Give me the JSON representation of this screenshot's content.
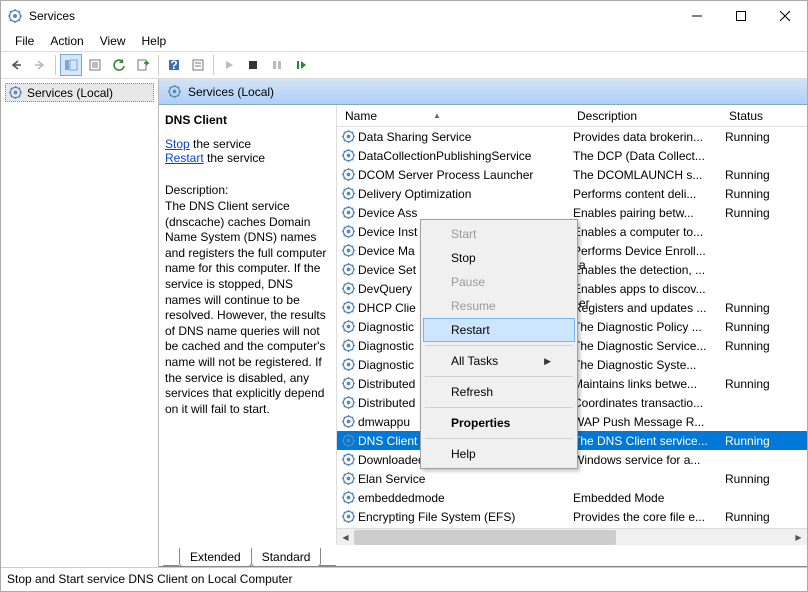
{
  "window": {
    "title": "Services"
  },
  "menu": {
    "file": "File",
    "action": "Action",
    "view": "View",
    "help": "Help"
  },
  "leftpane": {
    "root": "Services (Local)"
  },
  "header": {
    "label": "Services (Local)"
  },
  "detail": {
    "service_name": "DNS Client",
    "stop_link": "Stop",
    "stop_suffix": " the service",
    "restart_link": "Restart",
    "restart_suffix": " the service",
    "desc_label": "Description:",
    "desc_text": "The DNS Client service (dnscache) caches Domain Name System (DNS) names and registers the full computer name for this computer. If the service is stopped, DNS names will continue to be resolved. However, the results of DNS name queries will not be cached and the computer's name will not be registered. If the service is disabled, any services that explicitly depend on it will fail to start."
  },
  "columns": {
    "name": "Name",
    "description": "Description",
    "status": "Status"
  },
  "rows": [
    {
      "name": "Data Sharing Service",
      "desc": "Provides data brokerin...",
      "status": "Running"
    },
    {
      "name": "DataCollectionPublishingService",
      "desc": "The DCP (Data Collect...",
      "status": ""
    },
    {
      "name": "DCOM Server Process Launcher",
      "desc": "The DCOMLAUNCH s...",
      "status": "Running"
    },
    {
      "name": "Delivery Optimization",
      "desc": "Performs content deli...",
      "status": "Running"
    },
    {
      "name": "Device Ass",
      "desc": "Enables pairing betw...",
      "status": "Running"
    },
    {
      "name": "Device Inst",
      "desc": "Enables a computer to...",
      "status": ""
    },
    {
      "name": "Device Ma",
      "desc": "Performs Device Enroll...",
      "status": ""
    },
    {
      "name": "Device Set",
      "desc": "Enables the detection, ...",
      "status": ""
    },
    {
      "name": "DevQuery",
      "desc": "Enables apps to discov...",
      "status": ""
    },
    {
      "name": "DHCP Clie",
      "desc": "Registers and updates ...",
      "status": "Running"
    },
    {
      "name": "Diagnostic",
      "desc": "The Diagnostic Policy ...",
      "status": "Running"
    },
    {
      "name": "Diagnostic",
      "desc": "The Diagnostic Service...",
      "status": "Running"
    },
    {
      "name": "Diagnostic",
      "desc": "The Diagnostic Syste...",
      "status": ""
    },
    {
      "name": "Distributed",
      "desc": "Maintains links betwe...",
      "status": "Running"
    },
    {
      "name": "Distributed",
      "desc": "Coordinates transactio...",
      "status": ""
    },
    {
      "name": "dmwappu",
      "desc": "WAP Push Message R...",
      "status": ""
    },
    {
      "name": "DNS Client",
      "desc": "The DNS Client service...",
      "status": "Running",
      "selected": true
    },
    {
      "name": "Downloaded Maps Manager",
      "desc": "Windows service for a...",
      "status": ""
    },
    {
      "name": "Elan Service",
      "desc": "",
      "status": "Running"
    },
    {
      "name": "embeddedmode",
      "desc": "Embedded Mode",
      "status": ""
    },
    {
      "name": "Encrypting File System (EFS)",
      "desc": "Provides the core file e...",
      "status": "Running"
    }
  ],
  "context_menu": {
    "start": "Start",
    "stop": "Stop",
    "pause": "Pause",
    "resume": "Resume",
    "restart": "Restart",
    "all_tasks": "All Tasks",
    "refresh": "Refresh",
    "properties": "Properties",
    "help": "Help"
  },
  "tabs": {
    "extended": "Extended",
    "standard": "Standard"
  },
  "statusbar": {
    "text": "Stop and Start service DNS Client on Local Computer"
  },
  "partial_labels": {
    "a": "a",
    "er": "er"
  }
}
